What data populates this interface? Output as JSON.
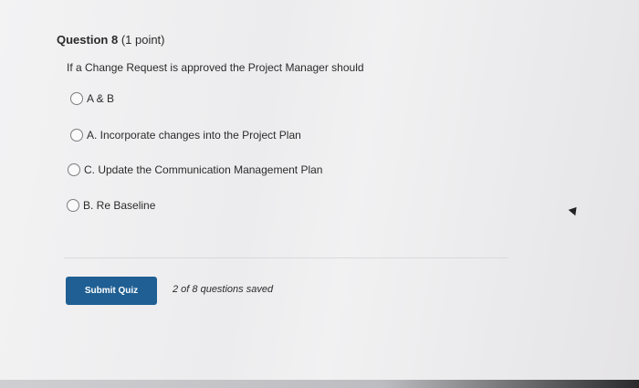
{
  "question": {
    "title": "Question 8",
    "points": "(1 point)",
    "text": "If a Change Request is approved the Project Manager should"
  },
  "options": [
    {
      "label": "A & B",
      "selected": false
    },
    {
      "label": "A. Incorporate changes into the Project Plan",
      "selected": false
    },
    {
      "label": "C. Update the Communication Management Plan",
      "selected": false
    },
    {
      "label": "B. Re Baseline",
      "selected": false
    }
  ],
  "footer": {
    "submit_label": "Submit Quiz",
    "save_status": "2 of 8 questions saved"
  },
  "colors": {
    "submit_button": "#1f5f93",
    "page_background": "#f0f0f1"
  }
}
